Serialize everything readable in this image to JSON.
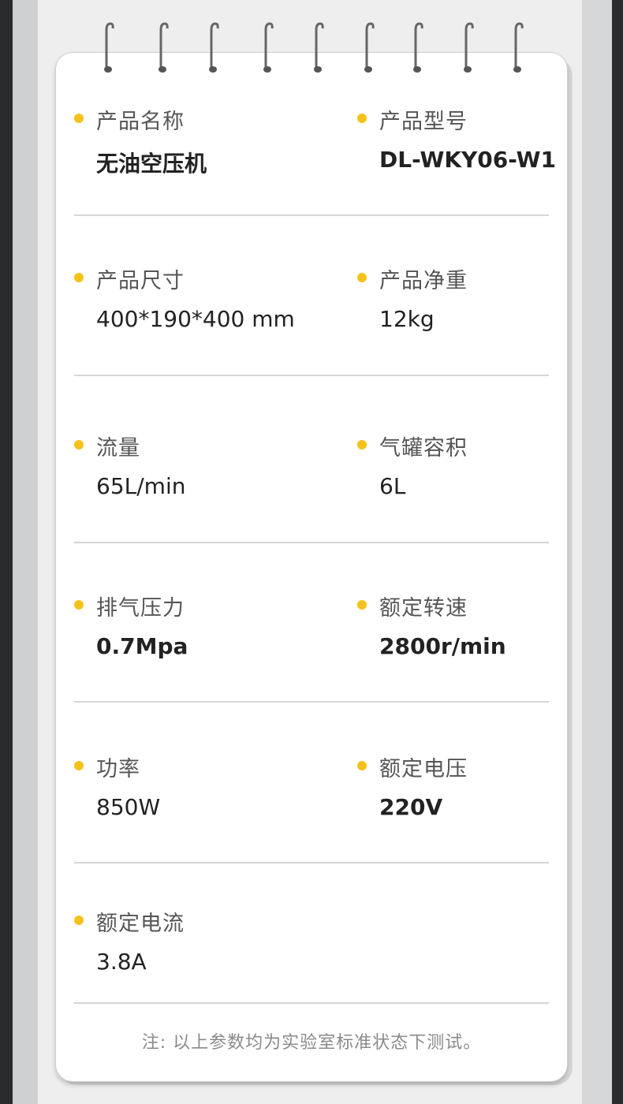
{
  "specs": [
    {
      "label": "产品名称",
      "value": "无油空压机"
    },
    {
      "label": "产品型号",
      "value": "DL-WKY06-W1"
    },
    {
      "label": "产品尺寸",
      "value": "400*190*400 mm"
    },
    {
      "label": "产品净重",
      "value": "12kg"
    },
    {
      "label": "流量",
      "value": "65L/min"
    },
    {
      "label": "气罐容积",
      "value": "6L"
    },
    {
      "label": "排气压力",
      "value": "0.7Mpa"
    },
    {
      "label": "额定转速",
      "value": "2800r/min"
    },
    {
      "label": "功率",
      "value": "850W"
    },
    {
      "label": "额定电压",
      "value": "220V"
    },
    {
      "label": "额定电流",
      "value": "3.8A"
    }
  ],
  "footnote": "注: 以上参数均为实验室标准状态下测试。",
  "colors": {
    "bullet": "#f4c21a",
    "label": "#555555",
    "value": "#222222"
  }
}
